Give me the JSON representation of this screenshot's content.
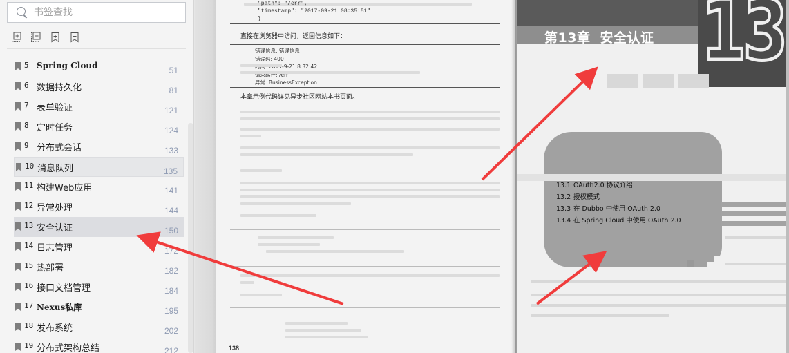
{
  "sidebar": {
    "search_placeholder": "书签查找",
    "tools": [
      {
        "name": "expand-all-icon"
      },
      {
        "name": "collapse-all-icon"
      },
      {
        "name": "add-bookmark-icon"
      },
      {
        "name": "remove-bookmark-icon"
      }
    ],
    "bookmarks": [
      {
        "num": "5",
        "title": "Spring Cloud",
        "page": "51"
      },
      {
        "num": "6",
        "title": "数据持久化",
        "page": "81"
      },
      {
        "num": "7",
        "title": "表单验证",
        "page": "121"
      },
      {
        "num": "8",
        "title": "定时任务",
        "page": "124"
      },
      {
        "num": "9",
        "title": "分布式会话",
        "page": "133"
      },
      {
        "num": "10",
        "title": "消息队列",
        "page": "135"
      },
      {
        "num": "11",
        "title": "构建Web应用",
        "page": "141"
      },
      {
        "num": "12",
        "title": "异常处理",
        "page": "144"
      },
      {
        "num": "13",
        "title": "安全认证",
        "page": "150"
      },
      {
        "num": "14",
        "title": "日志管理",
        "page": "172"
      },
      {
        "num": "15",
        "title": "热部署",
        "page": "182"
      },
      {
        "num": "16",
        "title": "接口文档管理",
        "page": "184"
      },
      {
        "num": "17",
        "title": "Nexus私库",
        "page": "195"
      },
      {
        "num": "18",
        "title": "发布系统",
        "page": "202"
      },
      {
        "num": "19",
        "title": "分布式架构总结",
        "page": "212"
      }
    ]
  },
  "left_page": {
    "code_top": "\"path\": \"/err\",\n\"timestamp\": \"2017-09-21 08:35:51\"\n}",
    "para1": "直接在浏览器中访问，返回信息如下：",
    "code_box": "错误信息: 错误信息\n错误码: 400\n时间: 2017-9-21 8:32:42\n请求路径: /err\n异常: BusinessException",
    "para2": "本章示例代码详见异步社区网站本书页面。",
    "page_number": "138"
  },
  "right_page": {
    "chapter_label": "第13章",
    "chapter_title": "安全认证",
    "chapter_big_number": "13",
    "toc": [
      {
        "n": "13.1",
        "t": "OAuth2.0 协议介绍"
      },
      {
        "n": "13.2",
        "t": "授权模式"
      },
      {
        "n": "13.3",
        "t": "在 Dubbo 中使用 OAuth 2.0"
      },
      {
        "n": "13.4",
        "t": "在 Spring Cloud 中使用 OAuth 2.0"
      }
    ],
    "ghost_heading": "13.1  OAuth2.0协议介绍"
  },
  "colors": {
    "annotation_arrow": "#f03c3c",
    "selected_bookmark_bg": "#dcdde1",
    "page_number_text": "#8f9bb3"
  }
}
